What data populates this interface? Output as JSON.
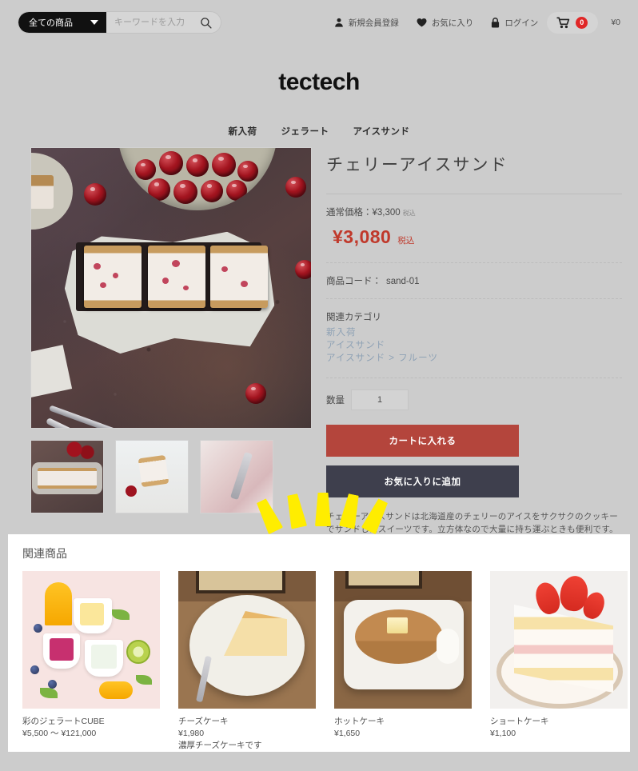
{
  "header": {
    "search": {
      "category_label": "全ての商品",
      "placeholder": "キーワードを入力",
      "value": "",
      "search_icon": "search-icon",
      "caret_icon": "chevron-down-icon"
    },
    "utility": [
      {
        "icon": "user-icon",
        "label": "新規会員登録"
      },
      {
        "icon": "heart-icon",
        "label": "お気に入り"
      },
      {
        "icon": "lock-icon",
        "label": "ログイン"
      }
    ],
    "cart": {
      "icon": "cart-icon",
      "badge": "0",
      "total": "¥0"
    }
  },
  "brand": {
    "name": "tectech"
  },
  "nav": {
    "items": [
      {
        "label": "新入荷"
      },
      {
        "label": "ジェラート"
      },
      {
        "label": "アイスサンド"
      }
    ]
  },
  "product": {
    "title": "チェリーアイスサンド",
    "regular_price_label": "通常価格：",
    "regular_price": "¥3,300",
    "regular_tax": "税込",
    "sale_price": "¥3,080",
    "sale_tax": "税込",
    "code_label": "商品コード：",
    "code_value": "sand-01",
    "category_heading": "関連カテゴリ",
    "categories": [
      {
        "label": "新入荷"
      },
      {
        "label": "アイスサンド"
      },
      {
        "label": "アイスサンド > フルーツ"
      }
    ],
    "qty_label": "数量",
    "qty_value": "1",
    "add_to_cart_label": "カートに入れる",
    "add_to_favorite_label": "お気に入りに追加",
    "description": "チェリーアイスサンドは北海道産のチェリーのアイスをサクサクのクッキーでサンドしたスイーツです。立方体なので大量に持ち運ぶときも便利です。\nいまだけ、頑丈な箱つきです。",
    "gallery": {
      "main_alt": "cherry-ice-sandwich-main-photo",
      "thumbnails": [
        {
          "alt": "cherry-ice-sandwich-tray-thumb"
        },
        {
          "alt": "cherry-ice-sandwich-cubes-thumb"
        },
        {
          "alt": "cherry-ice-cream-scoop-thumb"
        }
      ]
    }
  },
  "related": {
    "title": "関連商品",
    "items": [
      {
        "name": "彩のジェラートCUBE",
        "price": "¥5,500 ～ ¥121,000",
        "note": "",
        "alt": "colorful-gelato-cubes-photo"
      },
      {
        "name": "チーズケーキ",
        "price": "¥1,980",
        "note": "濃厚チーズケーキです",
        "alt": "cheesecake-slice-photo"
      },
      {
        "name": "ホットケーキ",
        "price": "¥1,650",
        "note": "",
        "alt": "pancake-with-butter-photo"
      },
      {
        "name": "ショートケーキ",
        "price": "¥1,100",
        "note": "",
        "alt": "strawberry-shortcake-photo"
      }
    ]
  },
  "annotation": {
    "type": "yellow-burst-rays",
    "ray_count": 5,
    "color": "#ffed00"
  },
  "colors": {
    "page_background": "#cccccc",
    "accent_sale": "#c0392b",
    "cart_button": "#b4453c",
    "favorite_button": "#3e3f4d",
    "badge_red": "#e02727",
    "category_link": "#8fa2b5"
  }
}
